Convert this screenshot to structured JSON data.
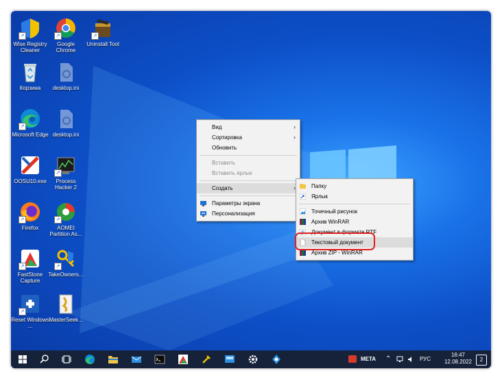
{
  "desktop_icons": [
    {
      "label": "Wise Registry Cleaner",
      "icon": "wise-registry-cleaner-icon"
    },
    {
      "label": "Google Chrome",
      "icon": "chrome-icon"
    },
    {
      "label": "Uninstall Tool",
      "icon": "uninstall-tool-icon"
    },
    {
      "label": "Корзина",
      "icon": "recycle-bin-icon"
    },
    {
      "label": "desktop.ini",
      "icon": "ini-file-icon"
    },
    {
      "label": "Microsoft Edge",
      "icon": "edge-icon"
    },
    {
      "label": "desktop.ini",
      "icon": "ini-file-icon"
    },
    {
      "label": "OOSU10.exe",
      "icon": "oosu10-icon"
    },
    {
      "label": "Process Hacker 2",
      "icon": "process-hacker-icon"
    },
    {
      "label": "Firefox",
      "icon": "firefox-icon"
    },
    {
      "label": "AOMEI Partition As...",
      "icon": "aomei-icon"
    },
    {
      "label": "FastStone Capture",
      "icon": "faststone-icon"
    },
    {
      "label": "TakeOwners...",
      "icon": "takeowner-icon"
    },
    {
      "label": "Reset Windows ...",
      "icon": "reset-windows-icon"
    },
    {
      "label": "MasterSeek...",
      "icon": "masterseeker-icon"
    }
  ],
  "context_menu": {
    "view": "Вид",
    "sort": "Сортировка",
    "refresh": "Обновить",
    "paste": "Вставить",
    "paste_shortcut": "Вставить ярлык",
    "create": "Создать",
    "display_settings": "Параметры экрана",
    "personalize": "Персонализация"
  },
  "submenu": {
    "folder": "Папку",
    "shortcut": "Ярлык",
    "bitmap": "Точечный рисунок",
    "winrar": "Архив WinRAR",
    "rtf": "Документ в формате RTF",
    "text_doc": "Текстовый документ",
    "zip": "Архив ZIP - WinRAR"
  },
  "taskbar": {
    "meta_label": "META",
    "language": "РУС",
    "time": "16:47",
    "date": "12.08.2022",
    "notification_count": "2"
  },
  "colors": {
    "highlight": "#e11d1d",
    "taskbar": "#15223a",
    "desktop": "#1a72e8"
  }
}
